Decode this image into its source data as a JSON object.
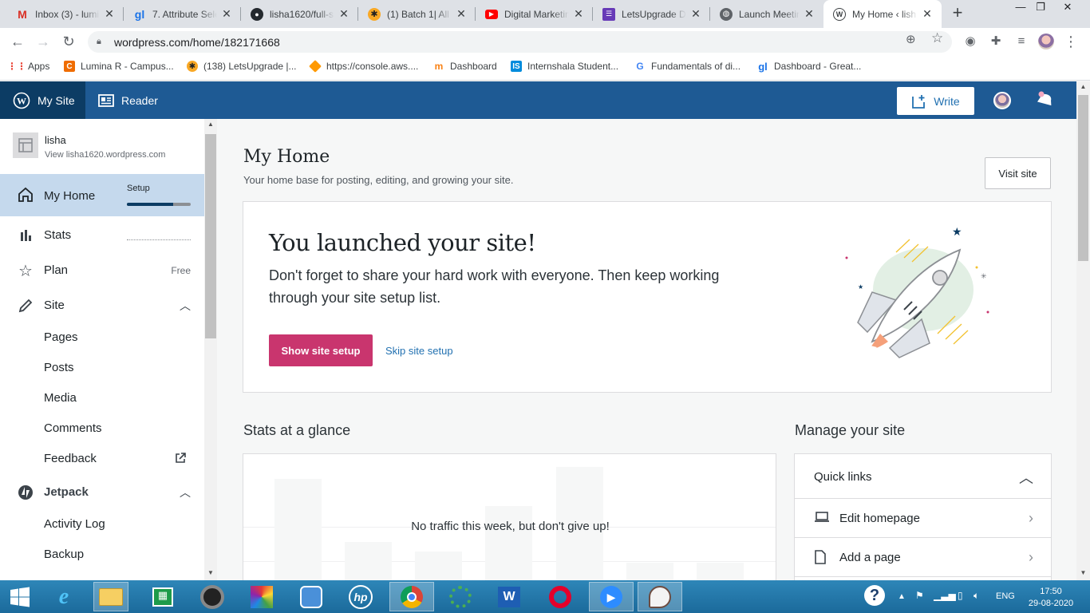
{
  "browser": {
    "tabs": [
      {
        "title": "Inbox (3) - lumi",
        "icon": "gmail-icon"
      },
      {
        "title": "7. Attribute Sele",
        "icon": "greatlearning-icon"
      },
      {
        "title": "lisha1620/full-s",
        "icon": "github-icon"
      },
      {
        "title": "(1) Batch 1| All",
        "icon": "letsupgrade-icon"
      },
      {
        "title": "Digital Marketin",
        "icon": "youtube-icon"
      },
      {
        "title": "LetsUpgrade D",
        "icon": "forms-icon"
      },
      {
        "title": "Launch Meeting",
        "icon": "globe-icon"
      },
      {
        "title": "My Home ‹ lish",
        "icon": "wordpress-icon"
      }
    ],
    "url": "wordpress.com/home/182171668",
    "bookmarks": [
      {
        "label": "Apps",
        "icon": "apps-grid-icon"
      },
      {
        "label": "Lumina R - Campus...",
        "icon": "lumina-icon"
      },
      {
        "label": "(138) LetsUpgrade |...",
        "icon": "letsupgrade-icon"
      },
      {
        "label": "https://console.aws....",
        "icon": "aws-icon"
      },
      {
        "label": "Dashboard",
        "icon": "moodle-icon"
      },
      {
        "label": "Internshala Student...",
        "icon": "internshala-icon"
      },
      {
        "label": "Fundamentals of di...",
        "icon": "google-icon"
      },
      {
        "label": "Dashboard - Great...",
        "icon": "greatlearning-icon"
      }
    ]
  },
  "masterbar": {
    "my_site": "My Site",
    "reader": "Reader",
    "write": "Write"
  },
  "sidebar": {
    "site_name": "lisha",
    "site_url": "View lisha1620.wordpress.com",
    "home": {
      "label": "My Home",
      "setup_label": "Setup",
      "setup_progress": 0.72
    },
    "stats": "Stats",
    "plan": {
      "label": "Plan",
      "badge": "Free"
    },
    "site": {
      "label": "Site",
      "items": [
        "Pages",
        "Posts",
        "Media",
        "Comments",
        "Feedback"
      ]
    },
    "jetpack": {
      "label": "Jetpack",
      "items": [
        "Activity Log",
        "Backup"
      ]
    }
  },
  "main": {
    "title": "My Home",
    "subtitle": "Your home base for posting, editing, and growing your site.",
    "visit_site": "Visit site",
    "launch": {
      "title": "You launched your site!",
      "body": "Don't forget to share your hard work with everyone. Then keep working through your site setup list.",
      "primary": "Show site setup",
      "secondary": "Skip site setup"
    },
    "stats": {
      "heading": "Stats at a glance",
      "empty": "No traffic this week, but don't give up!"
    },
    "manage": {
      "heading": "Manage your site",
      "quick_links_title": "Quick links",
      "links": [
        {
          "label": "Edit homepage",
          "icon": "laptop-icon"
        },
        {
          "label": "Add a page",
          "icon": "page-icon"
        }
      ]
    }
  },
  "taskbar": {
    "apps": [
      "start",
      "internet-explorer",
      "file-explorer",
      "store",
      "camera",
      "paint-3d",
      "finder",
      "hp",
      "chrome",
      "circle-app",
      "word",
      "opera",
      "zoom",
      "paint"
    ],
    "lang": "ENG",
    "time": "17:50",
    "date": "29-08-2020"
  },
  "colors": {
    "wp_blue": "#1e5a94",
    "wp_dark": "#0c3c64",
    "accent_pink": "#c9356e",
    "link": "#2271b1"
  }
}
